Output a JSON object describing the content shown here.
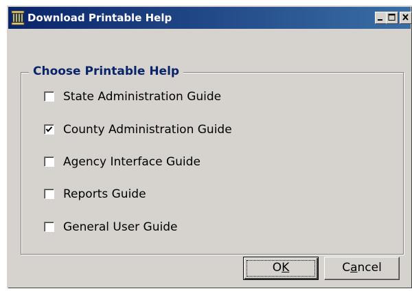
{
  "window": {
    "title": "Download Printable Help",
    "controls": {
      "minimize": "minimize-icon",
      "maximize": "maximize-icon",
      "close": "close-icon"
    }
  },
  "group": {
    "title": "Choose Printable Help",
    "options": [
      {
        "label": "State Administration Guide",
        "checked": false
      },
      {
        "label": "County Administration Guide",
        "checked": true
      },
      {
        "label": "Agency Interface Guide",
        "checked": false
      },
      {
        "label": "Reports Guide",
        "checked": false
      },
      {
        "label": "General User Guide",
        "checked": false
      }
    ]
  },
  "buttons": {
    "ok": {
      "pre": "O",
      "accel": "K",
      "post": ""
    },
    "cancel": {
      "pre": "C",
      "accel": "a",
      "post": "ncel"
    }
  },
  "colors": {
    "title_bar_start": "#0a246a",
    "title_bar_end": "#3a6ea5",
    "dialog_face": "#d6d3ce",
    "group_title": "#0a246a"
  }
}
